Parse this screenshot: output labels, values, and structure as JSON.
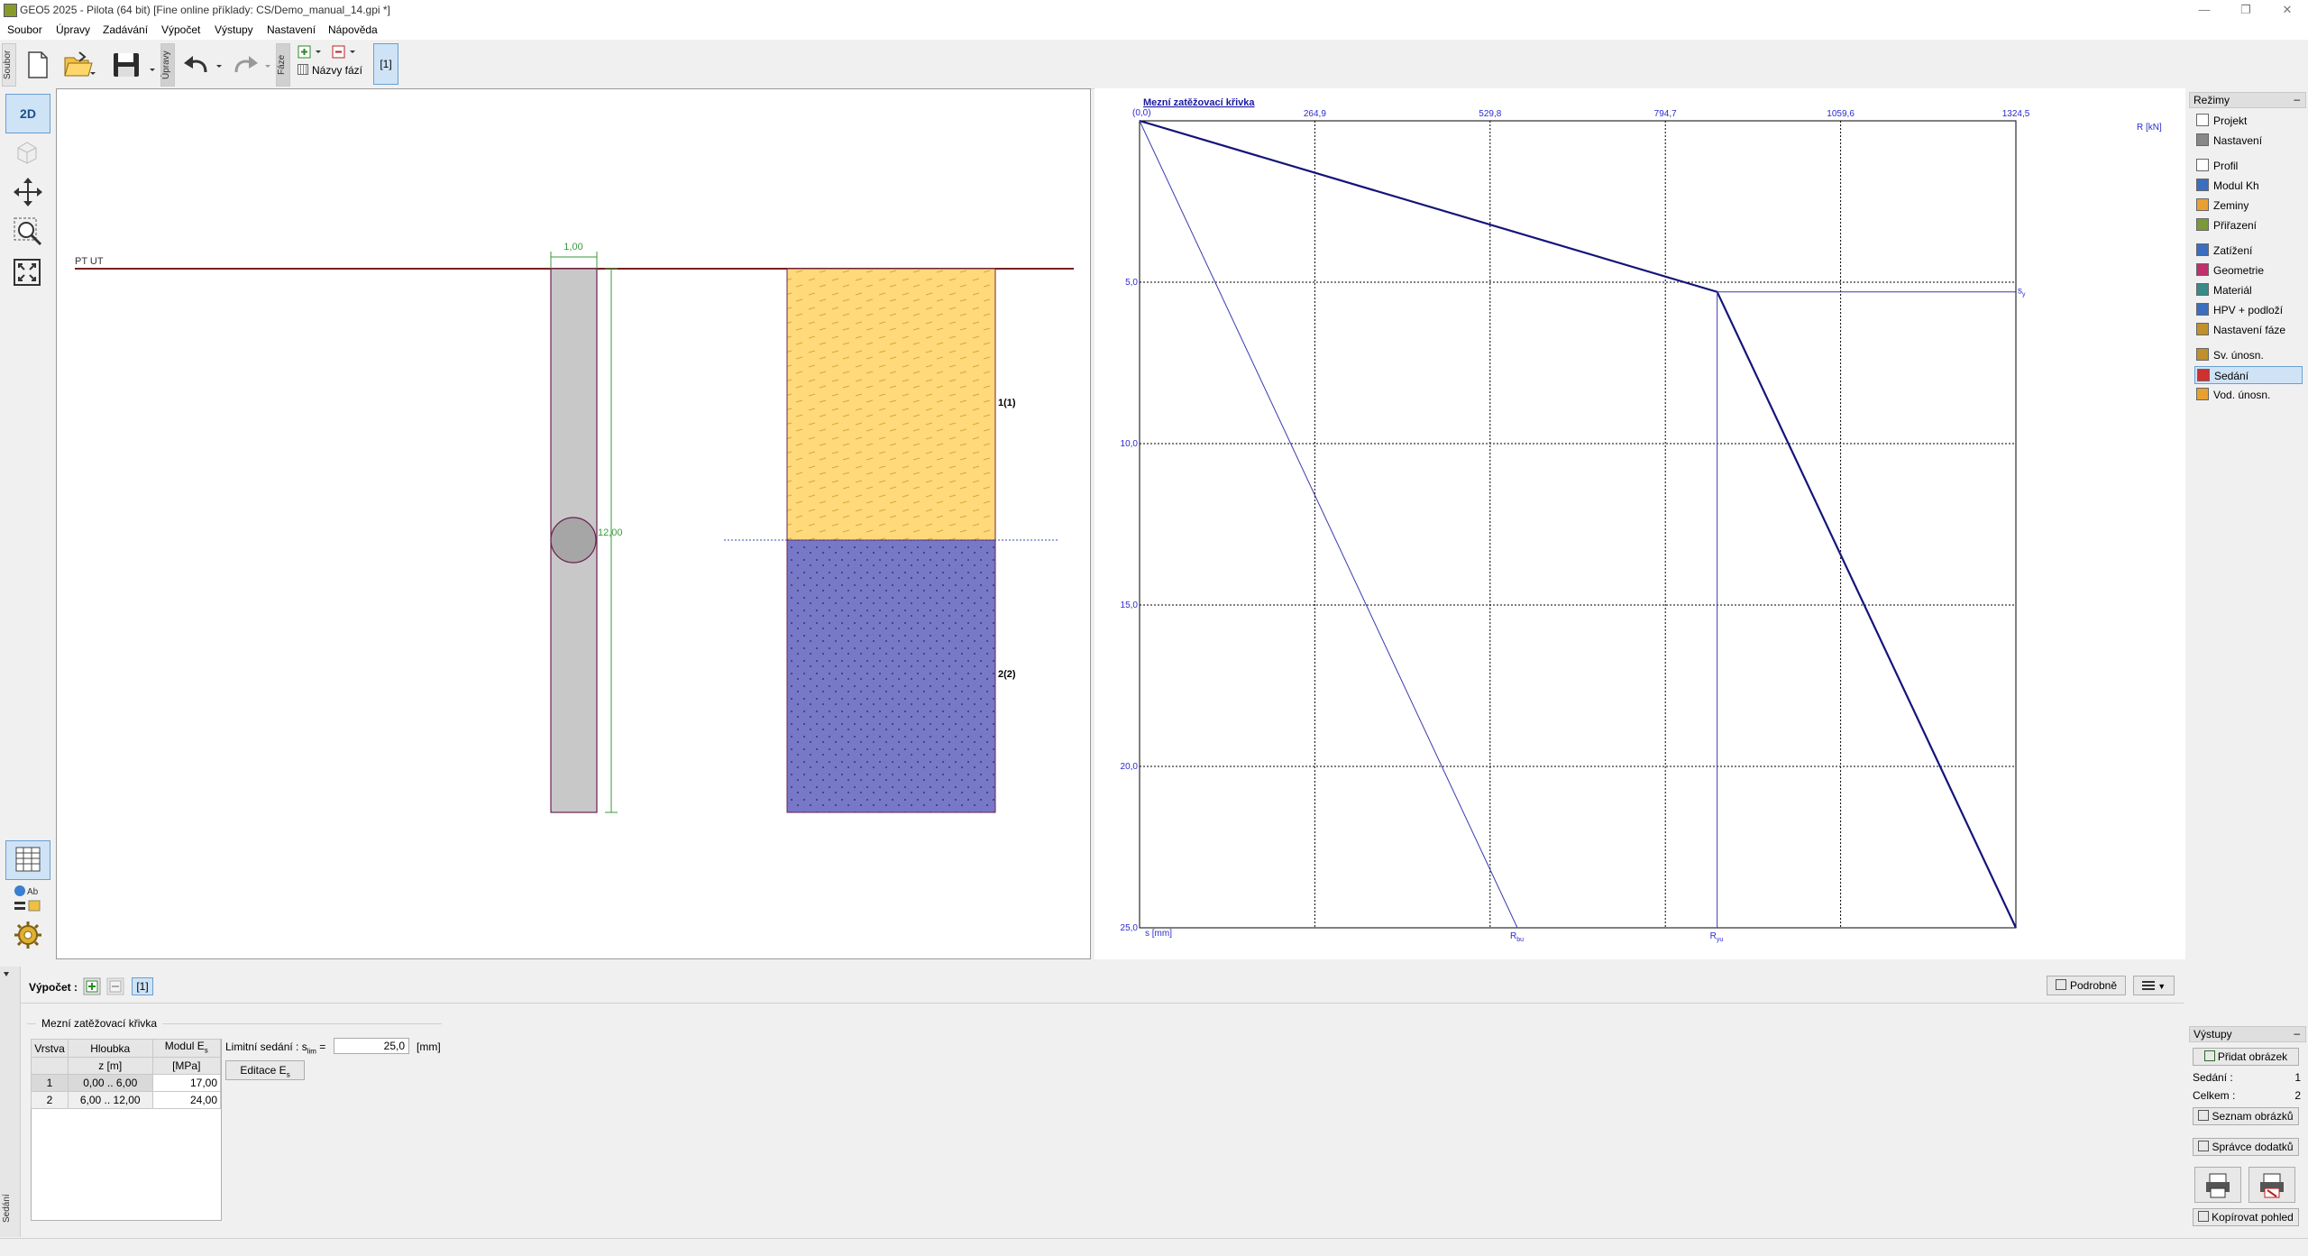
{
  "window": {
    "title": "GEO5 2025 - Pilota (64 bit) [Fine online příklady: CS/Demo_manual_14.gpi *]"
  },
  "menu": [
    "Soubor",
    "Úpravy",
    "Zadávání",
    "Výpočet",
    "Výstupy",
    "Nastavení",
    "Nápověda"
  ],
  "toolbar": {
    "soubor_tab": "Soubor",
    "upravy_tab": "Úpravy",
    "faze_tab": "Fáze",
    "phase_names_label": "Názvy fází",
    "phase_current": "[1]"
  },
  "left_tools": {
    "view_2d": "2D"
  },
  "left_view": {
    "terrain_label": "PT UT",
    "pile_diameter": "1,00",
    "pile_length": "12,00",
    "layer1_label": "1(1)",
    "layer2_label": "2(2)",
    "colors": {
      "layer1": "#ffd97a",
      "layer2": "#7878c8",
      "pile": "#c8c8c8",
      "terrain": "#7a2020"
    }
  },
  "right_view": {
    "title": "Mezní zatěžovací křivka",
    "origin_label": "(0,0)",
    "x_ticks": [
      "264,9",
      "529,8",
      "794,7",
      "1059,6",
      "1324,5"
    ],
    "x_axis_label": "R [kN]",
    "y_ticks": [
      "5,0",
      "10,0",
      "15,0",
      "20,0",
      "25,0"
    ],
    "y_axis_label": "s [mm]",
    "sy_label": "s",
    "sy_sub": "y",
    "rbu_label": "R",
    "rbu_sub": "bu",
    "ryu_label": "R",
    "ryu_sub": "yu"
  },
  "chart_data": {
    "type": "line",
    "title": "Mezní zatěžovací křivka",
    "xlabel": "R [kN]",
    "ylabel": "s [mm]",
    "xlim": [
      0,
      1324.5
    ],
    "ylim": [
      0,
      25.0
    ],
    "y_inverted": true,
    "grid": true,
    "x_tick_labels": [
      "264,9",
      "529,8",
      "794,7",
      "1059,6",
      "1324,5"
    ],
    "y_tick_labels": [
      "5,0",
      "10,0",
      "15,0",
      "20,0",
      "25,0"
    ],
    "series": [
      {
        "name": "",
        "x": [
          0,
          873,
          1324.5
        ],
        "y": [
          0,
          5.3,
          25.0
        ],
        "style": "thick"
      },
      {
        "name": "",
        "x": [
          0,
          571
        ],
        "y": [
          0,
          25.0
        ],
        "style": "thin"
      },
      {
        "name": "",
        "x": [
          873,
          873
        ],
        "y": [
          5.3,
          25.0
        ],
        "style": "thin"
      },
      {
        "name": "",
        "x": [
          873,
          1324.5
        ],
        "y": [
          5.3,
          5.3
        ],
        "style": "thin"
      }
    ],
    "annotations": [
      "s_y",
      "R_bu",
      "R_yu"
    ]
  },
  "modes": {
    "header": "Režimy",
    "items": [
      {
        "label": "Projekt",
        "icon": "project-icon",
        "color": "#ffffff"
      },
      {
        "label": "Nastavení",
        "icon": "gear-icon",
        "color": "#888888"
      },
      {
        "label": "Profil",
        "icon": "profile-icon",
        "color": "#ffffff"
      },
      {
        "label": "Modul Kh",
        "icon": "modulus-icon",
        "color": "#3a6fbf"
      },
      {
        "label": "Zeminy",
        "icon": "soil-icon",
        "color": "#e8a030"
      },
      {
        "label": "Přiřazení",
        "icon": "assign-icon",
        "color": "#7a9a3a"
      },
      {
        "label": "Zatížení",
        "icon": "load-icon",
        "color": "#3a6fbf"
      },
      {
        "label": "Geometrie",
        "icon": "geometry-icon",
        "color": "#c0306a"
      },
      {
        "label": "Materiál",
        "icon": "material-icon",
        "color": "#3a8a8a"
      },
      {
        "label": "HPV + podloží",
        "icon": "water-icon",
        "color": "#3a6fbf"
      },
      {
        "label": "Nastavení fáze",
        "icon": "phase-settings-icon",
        "color": "#c0902a"
      },
      {
        "label": "Sv. únosn.",
        "icon": "vertical-capacity-icon",
        "color": "#c0902a"
      },
      {
        "label": "Sedání",
        "icon": "settlement-icon",
        "color": "#d03030"
      },
      {
        "label": "Vod. únosn.",
        "icon": "horizontal-capacity-icon",
        "color": "#e8a030"
      }
    ],
    "selected": "Sedání"
  },
  "outputs": {
    "header": "Výstupy",
    "add_image": "Přidat obrázek",
    "sedani_label": "Sedání :",
    "sedani_value": "1",
    "total_label": "Celkem :",
    "total_value": "2",
    "image_list": "Seznam obrázků",
    "appendix_manager": "Správce dodatků",
    "copy_view": "Kopírovat pohled"
  },
  "calc": {
    "label": "Výpočet :",
    "phase_current": "[1]",
    "detail_button": "Podrobně",
    "group_title": "Mezní zatěžovací křivka",
    "table": {
      "headers": [
        "Vrstva",
        "Hloubka",
        "Modul E"
      ],
      "headers2": [
        "",
        "z [m]",
        "[MPa]"
      ],
      "modul_sub": "s",
      "rows": [
        {
          "layer": "1",
          "depth": "0,00 .. 6,00",
          "modulus": "17,00"
        },
        {
          "layer": "2",
          "depth": "6,00 .. 12,00",
          "modulus": "24,00"
        }
      ]
    },
    "limit_label": "Limitní sedání : s",
    "limit_sub": "lim",
    "limit_eq": "=",
    "limit_value": "25,0",
    "limit_unit": "[mm]",
    "edit_button": "Editace E",
    "edit_sub": "s",
    "side_tab": "Sedání"
  }
}
